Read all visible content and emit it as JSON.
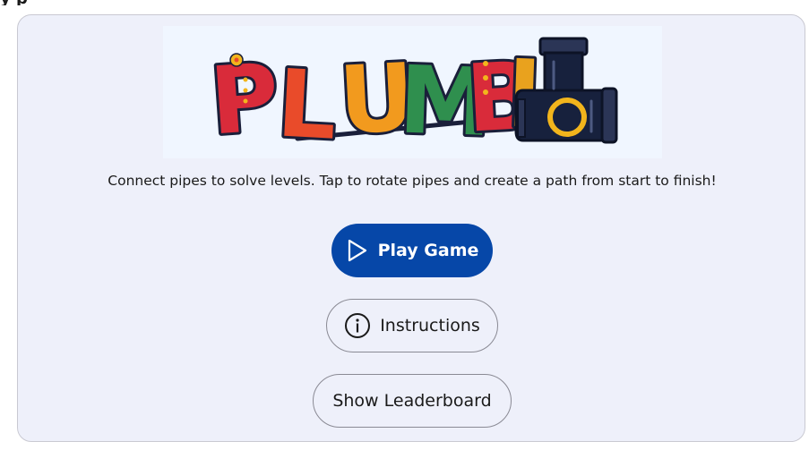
{
  "header": {
    "partial_title": "y   p"
  },
  "logo": {
    "text": "PLUMBI",
    "letters": [
      "P",
      "L",
      "U",
      "M",
      "B",
      "I"
    ],
    "letter_colors": [
      "#d92b3a",
      "#e94b2a",
      "#f29a1e",
      "#2f8f4e",
      "#d92b3a",
      "#e9a21e"
    ],
    "outline_color": "#1a1f3a",
    "pipe_color": "#17213d",
    "ring_color": "#f2b51c",
    "background": "#f0f6ff"
  },
  "description": "Connect pipes to solve levels. Tap to rotate pipes and create a path from start to finish!",
  "buttons": {
    "play": {
      "label": "Play Game",
      "icon": "play-icon"
    },
    "instructions": {
      "label": "Instructions",
      "icon": "info-icon"
    },
    "leaderboard": {
      "label": "Show Leaderboard"
    }
  },
  "colors": {
    "card_background": "#eef0fa",
    "primary_button": "#0647a8",
    "text": "#1a1a1a"
  }
}
